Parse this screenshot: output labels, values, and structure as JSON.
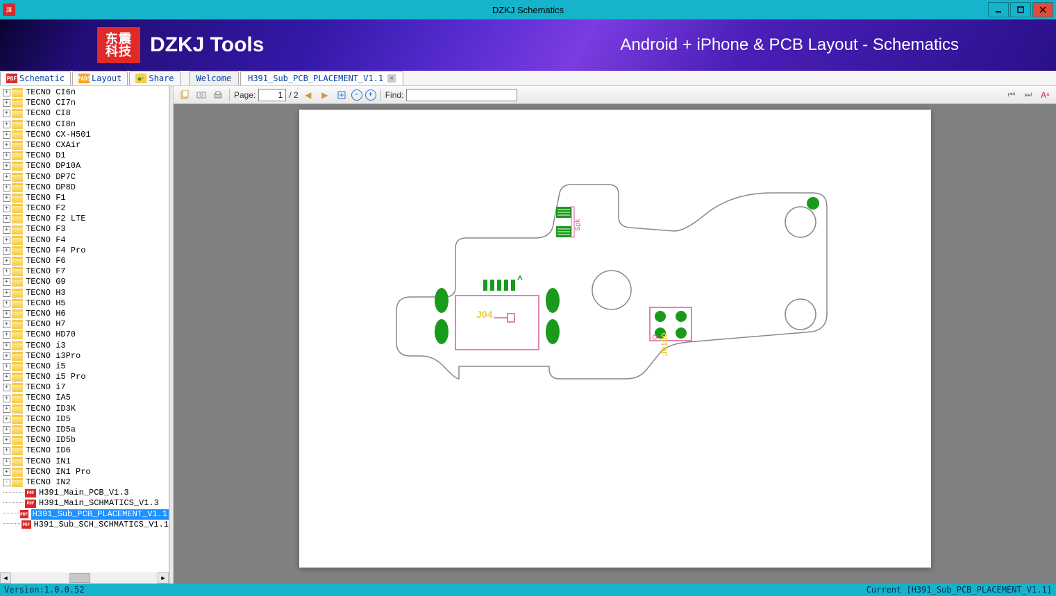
{
  "window": {
    "title": "DZKJ Schematics"
  },
  "banner": {
    "logo_top": "东震",
    "logo_bottom": "科技",
    "tools": "DZKJ Tools",
    "tagline": "Android + iPhone & PCB Layout - Schematics"
  },
  "sidetabs": {
    "schematic": "Schematic",
    "layout": "Layout",
    "share": "Share"
  },
  "doctabs": {
    "welcome": "Welcome",
    "current": "H391_Sub_PCB_PLACEMENT_V1.1"
  },
  "toolbar": {
    "page_label": "Page:",
    "page_current": "1",
    "page_total": "/ 2",
    "find_label": "Find:",
    "find_value": ""
  },
  "tree": {
    "folders": [
      "TECNO CI6n",
      "TECNO CI7n",
      "TECNO CI8",
      "TECNO CI8n",
      "TECNO CX-H501",
      "TECNO CXAir",
      "TECNO D1",
      "TECNO DP10A",
      "TECNO DP7C",
      "TECNO DP8D",
      "TECNO F1",
      "TECNO F2",
      "TECNO F2 LTE",
      "TECNO F3",
      "TECNO F4",
      "TECNO F4 Pro",
      "TECNO F6",
      "TECNO F7",
      "TECNO G9",
      "TECNO H3",
      "TECNO H5",
      "TECNO H6",
      "TECNO H7",
      "TECNO HD70",
      "TECNO i3",
      "TECNO i3Pro",
      "TECNO i5",
      "TECNO i5 Pro",
      "TECNO i7",
      "TECNO IA5",
      "TECNO ID3K",
      "TECNO ID5",
      "TECNO ID5a",
      "TECNO ID5b",
      "TECNO ID6",
      "TECNO IN1",
      "TECNO IN1 Pro"
    ],
    "expanded_folder": "TECNO IN2",
    "files": [
      "H391_Main_PCB_V1.3",
      "H391_Main_SCHMATICS_V1.3",
      "H391_Sub_PCB_PLACEMENT_V1.1",
      "H391_Sub_SCH_SCHMATICS_V1.1"
    ],
    "selected_index": 2
  },
  "pcb_labels": {
    "comp1": "J04",
    "comp2": "J0100",
    "comp3": "Spk"
  },
  "status": {
    "version": "Version:1.0.0.52",
    "current": "Current [H391_Sub_PCB_PLACEMENT_V1.1]"
  }
}
